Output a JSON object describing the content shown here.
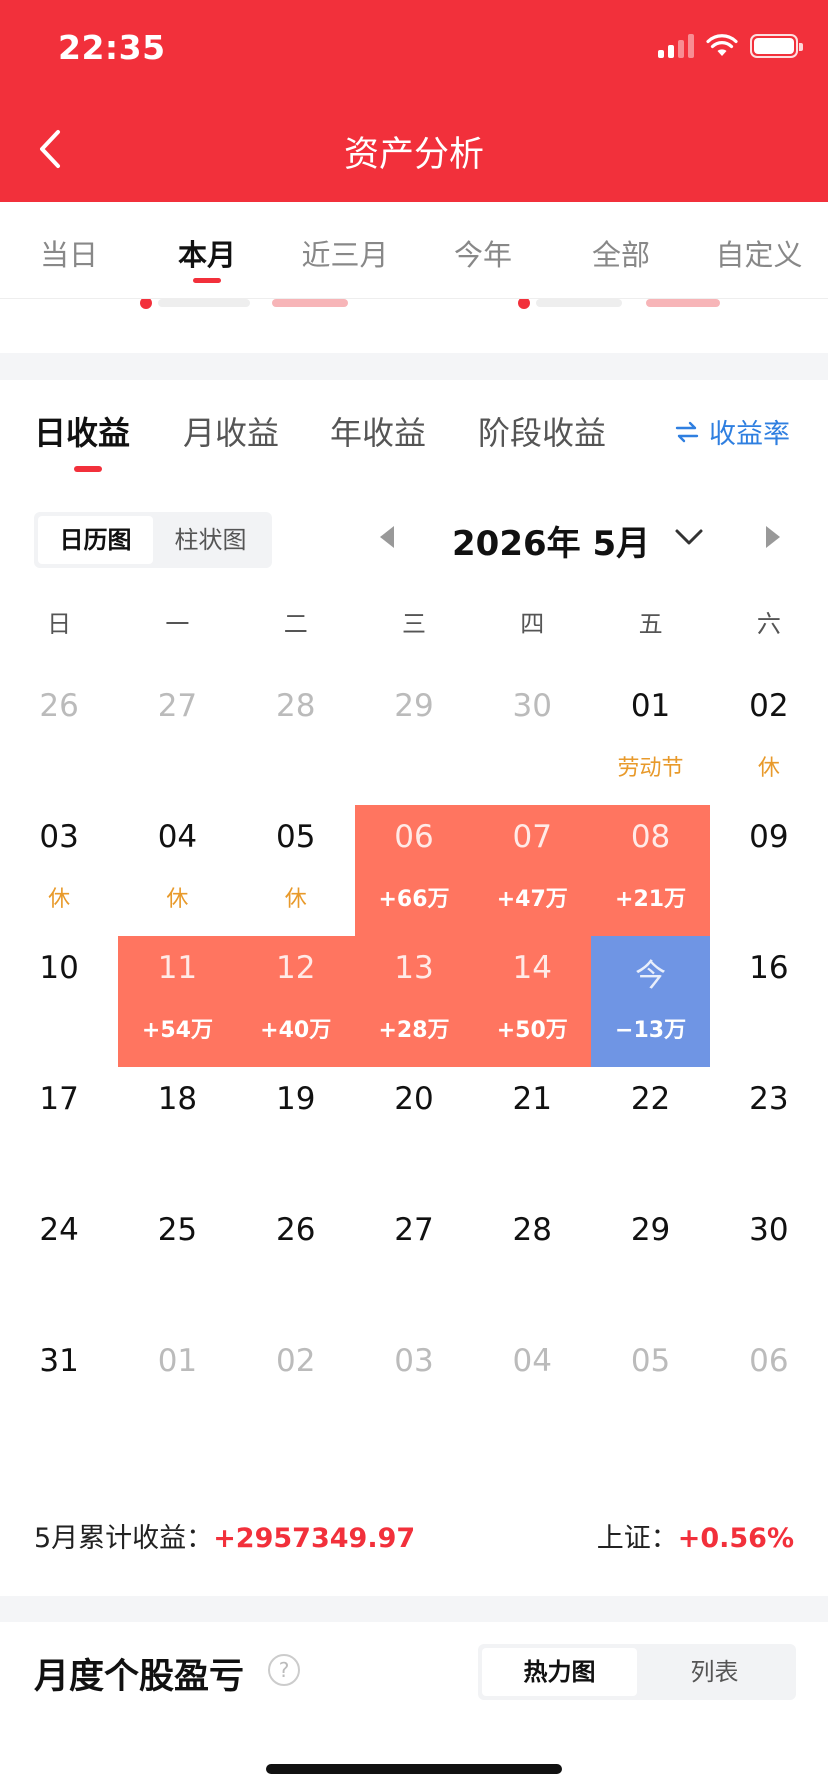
{
  "status_bar": {
    "time": "22:35"
  },
  "header": {
    "title": "资产分析"
  },
  "period_tabs": [
    {
      "label": "当日",
      "active": false
    },
    {
      "label": "本月",
      "active": true
    },
    {
      "label": "近三月",
      "active": false
    },
    {
      "label": "今年",
      "active": false
    },
    {
      "label": "全部",
      "active": false
    },
    {
      "label": "自定义",
      "active": false
    }
  ],
  "profit_tabs": [
    {
      "label": "日收益",
      "active": true
    },
    {
      "label": "月收益",
      "active": false
    },
    {
      "label": "年收益",
      "active": false
    },
    {
      "label": "阶段收益",
      "active": false
    }
  ],
  "rate_link": {
    "label": "收益率",
    "icon": "swap-arrows-icon"
  },
  "view_toggle": [
    {
      "label": "日历图",
      "active": true
    },
    {
      "label": "柱状图",
      "active": false
    }
  ],
  "month_nav": {
    "label": "2026年 5月"
  },
  "weekdays": [
    "日",
    "一",
    "二",
    "三",
    "四",
    "五",
    "六"
  ],
  "calendar_days": [
    {
      "num": "26",
      "other": true,
      "sub": "",
      "type": ""
    },
    {
      "num": "27",
      "other": true,
      "sub": "",
      "type": ""
    },
    {
      "num": "28",
      "other": true,
      "sub": "",
      "type": ""
    },
    {
      "num": "29",
      "other": true,
      "sub": "",
      "type": ""
    },
    {
      "num": "30",
      "other": true,
      "sub": "",
      "type": ""
    },
    {
      "num": "01",
      "other": false,
      "sub": "劳动节",
      "type": ""
    },
    {
      "num": "02",
      "other": false,
      "sub": "休",
      "type": ""
    },
    {
      "num": "03",
      "other": false,
      "sub": "休",
      "type": ""
    },
    {
      "num": "04",
      "other": false,
      "sub": "休",
      "type": ""
    },
    {
      "num": "05",
      "other": false,
      "sub": "休",
      "type": ""
    },
    {
      "num": "06",
      "other": false,
      "sub": "+66万",
      "type": "gain"
    },
    {
      "num": "07",
      "other": false,
      "sub": "+47万",
      "type": "gain"
    },
    {
      "num": "08",
      "other": false,
      "sub": "+21万",
      "type": "gain"
    },
    {
      "num": "09",
      "other": false,
      "sub": "",
      "type": ""
    },
    {
      "num": "10",
      "other": false,
      "sub": "",
      "type": ""
    },
    {
      "num": "11",
      "other": false,
      "sub": "+54万",
      "type": "gain"
    },
    {
      "num": "12",
      "other": false,
      "sub": "+40万",
      "type": "gain"
    },
    {
      "num": "13",
      "other": false,
      "sub": "+28万",
      "type": "gain"
    },
    {
      "num": "14",
      "other": false,
      "sub": "+50万",
      "type": "gain"
    },
    {
      "num": "今",
      "other": false,
      "sub": "−13万",
      "type": "loss"
    },
    {
      "num": "16",
      "other": false,
      "sub": "",
      "type": ""
    },
    {
      "num": "17",
      "other": false,
      "sub": "",
      "type": ""
    },
    {
      "num": "18",
      "other": false,
      "sub": "",
      "type": ""
    },
    {
      "num": "19",
      "other": false,
      "sub": "",
      "type": ""
    },
    {
      "num": "20",
      "other": false,
      "sub": "",
      "type": ""
    },
    {
      "num": "21",
      "other": false,
      "sub": "",
      "type": ""
    },
    {
      "num": "22",
      "other": false,
      "sub": "",
      "type": ""
    },
    {
      "num": "23",
      "other": false,
      "sub": "",
      "type": ""
    },
    {
      "num": "24",
      "other": false,
      "sub": "",
      "type": ""
    },
    {
      "num": "25",
      "other": false,
      "sub": "",
      "type": ""
    },
    {
      "num": "26",
      "other": false,
      "sub": "",
      "type": ""
    },
    {
      "num": "27",
      "other": false,
      "sub": "",
      "type": ""
    },
    {
      "num": "28",
      "other": false,
      "sub": "",
      "type": ""
    },
    {
      "num": "29",
      "other": false,
      "sub": "",
      "type": ""
    },
    {
      "num": "30",
      "other": false,
      "sub": "",
      "type": ""
    },
    {
      "num": "31",
      "other": false,
      "sub": "",
      "type": ""
    },
    {
      "num": "01",
      "other": true,
      "sub": "",
      "type": ""
    },
    {
      "num": "02",
      "other": true,
      "sub": "",
      "type": ""
    },
    {
      "num": "03",
      "other": true,
      "sub": "",
      "type": ""
    },
    {
      "num": "04",
      "other": true,
      "sub": "",
      "type": ""
    },
    {
      "num": "05",
      "other": true,
      "sub": "",
      "type": ""
    },
    {
      "num": "06",
      "other": true,
      "sub": "",
      "type": ""
    }
  ],
  "summary": {
    "cumulative_label": "5月累计收益：",
    "cumulative_value": "+2957349.97",
    "index_label": "上证：",
    "index_value": "+0.56%"
  },
  "monthly_section": {
    "title": "月度个股盈亏",
    "help": "?",
    "views": [
      {
        "label": "热力图",
        "active": true
      },
      {
        "label": "列表",
        "active": false
      }
    ]
  },
  "colors": {
    "brand_red": "#F2303B",
    "gain_cell": "#FF7560",
    "loss_cell": "#6F95E4",
    "holiday_text": "#E89A2B",
    "link_blue": "#2F7FE0"
  }
}
